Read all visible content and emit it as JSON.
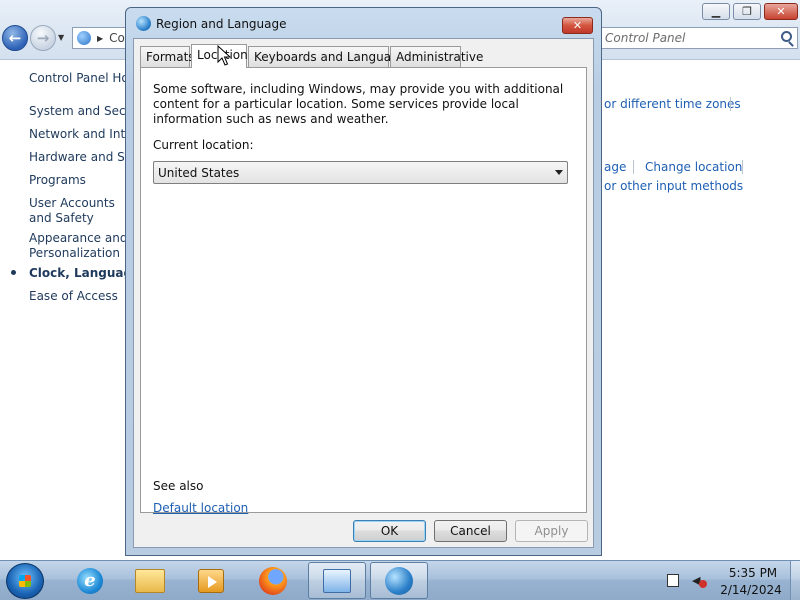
{
  "control_panel": {
    "address_text": "Co",
    "search_placeholder": "Control Panel",
    "sidebar": {
      "home": "Control Panel Ho",
      "items": [
        {
          "label": "System and Securi"
        },
        {
          "label": "Network and Inter"
        },
        {
          "label": "Hardware and Sou"
        },
        {
          "label": "Programs"
        },
        {
          "label": "User Accounts and Safety"
        },
        {
          "label": "Appearance and Personalization"
        },
        {
          "label": "Clock, Language, a"
        },
        {
          "label": "Ease of Access"
        }
      ]
    },
    "links": {
      "time_zones": "or different time zones",
      "language": "age",
      "change_location": "Change location",
      "input_methods": "or other input methods"
    }
  },
  "dialog": {
    "title": "Region and Language",
    "close_glyph": "✕",
    "tabs": [
      {
        "label": "Formats"
      },
      {
        "label": "Location"
      },
      {
        "label": "Keyboards and Languages"
      },
      {
        "label": "Administrative"
      }
    ],
    "active_tab": "Location",
    "description": "Some software, including Windows, may provide you with additional content for a particular location. Some services provide local information such as news and weather.",
    "current_location_label": "Current location:",
    "current_location_value": "United States",
    "see_also": "See also",
    "default_location_link": "Default location",
    "buttons": {
      "ok": "OK",
      "cancel": "Cancel",
      "apply": "Apply"
    }
  },
  "taskbar": {
    "apps": [
      {
        "icon": "internet-explorer-icon"
      },
      {
        "icon": "windows-explorer-icon"
      },
      {
        "icon": "media-player-icon"
      },
      {
        "icon": "firefox-icon"
      },
      {
        "icon": "control-panel-icon"
      },
      {
        "icon": "region-language-icon"
      }
    ],
    "clock": {
      "time": "5:35 PM",
      "date": "2/14/2024"
    }
  },
  "colors": {
    "link": "#1e5fb3",
    "sidebar_text": "#1e395b",
    "dialog_frame": "#b8cde4",
    "taskbar": "#a9c1db"
  }
}
